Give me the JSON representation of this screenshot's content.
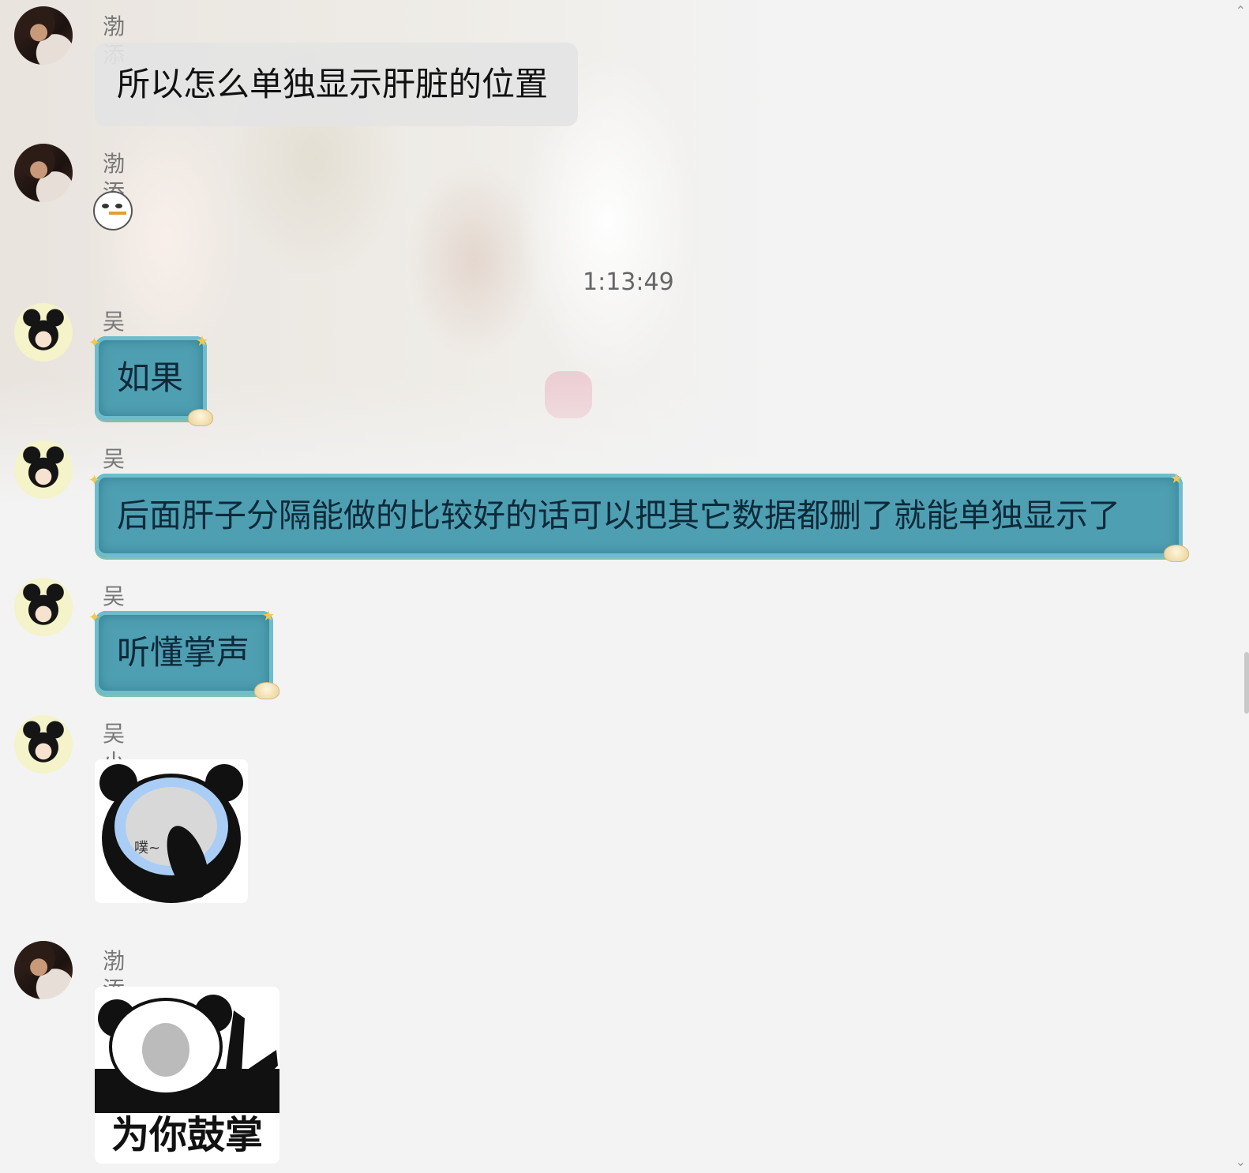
{
  "messages": [
    {
      "sender": "渤添",
      "type": "text",
      "style": "gray",
      "text": "所以怎么单独显示肝脏的位置"
    },
    {
      "sender": "渤添",
      "type": "sticker",
      "sticker": "smoking-face-icon"
    },
    {
      "sender": "吴小龙",
      "type": "text",
      "style": "teal",
      "text": "如果"
    },
    {
      "sender": "吴小龙",
      "type": "text",
      "style": "teal",
      "text": "后面肝子分隔能做的比较好的话可以把其它数据都删了就能单独显示了"
    },
    {
      "sender": "吴小龙",
      "type": "text",
      "style": "teal",
      "text": "听懂掌声"
    },
    {
      "sender": "吴小龙",
      "type": "image",
      "caption": "噗~"
    },
    {
      "sender": "渤添",
      "type": "image",
      "caption": "为你鼓掌"
    }
  ],
  "timestamp": "1:13:49",
  "colors": {
    "teal_bubble": "#4f9fb2",
    "gray_bubble": "#e4e4e4",
    "background": "#f3f3f3"
  }
}
